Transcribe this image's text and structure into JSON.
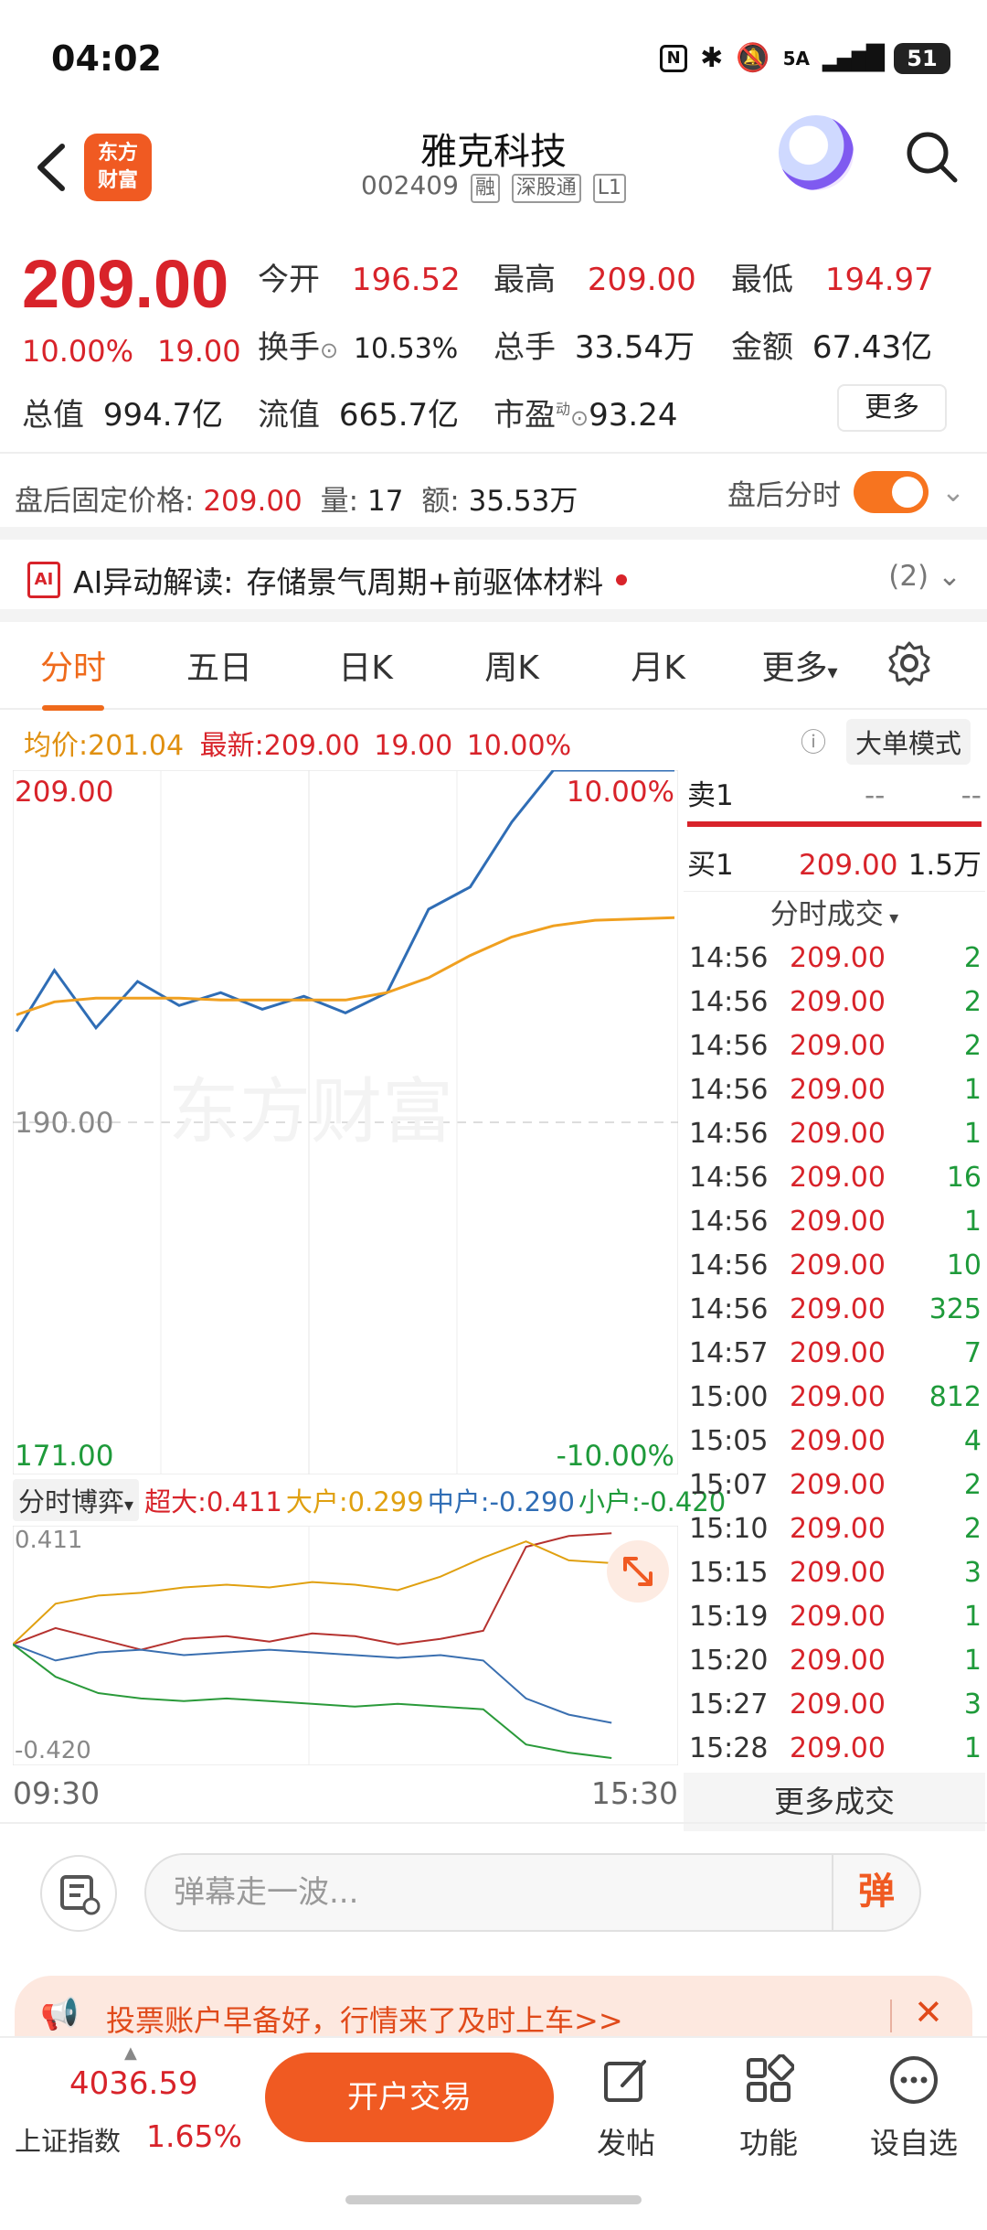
{
  "status": {
    "time": "04:02",
    "network": "5A",
    "battery": "51"
  },
  "header": {
    "logo_text": "东方财富",
    "name": "雅克科技",
    "code": "002409",
    "tags": [
      "融",
      "深股通",
      "L1"
    ]
  },
  "quote": {
    "price": "209.00",
    "pct": "10.00%",
    "change": "19.00",
    "rows": [
      [
        {
          "l": "今开",
          "v": "196.52",
          "c": "red"
        },
        {
          "l": "最高",
          "v": "209.00",
          "c": "red"
        },
        {
          "l": "最低",
          "v": "194.97",
          "c": "red"
        }
      ],
      [
        {
          "l": "换手",
          "v": "10.53%",
          "c": "dark",
          "info": true
        },
        {
          "l": "总手",
          "v": "33.54万",
          "c": "dark"
        },
        {
          "l": "金额",
          "v": "67.43亿",
          "c": "dark"
        }
      ],
      [
        {
          "l": "总值",
          "v": "994.7亿",
          "c": "dark"
        },
        {
          "l": "流值",
          "v": "665.7亿",
          "c": "dark"
        },
        {
          "l": "市盈",
          "v": "93.24",
          "c": "dark",
          "sup": "动",
          "info": true
        }
      ]
    ],
    "more_label": "更多"
  },
  "after_hours": {
    "label": "盘后固定价格:",
    "price": "209.00",
    "vol_label": "量:",
    "vol": "17",
    "amt_label": "额:",
    "amt": "35.53万",
    "toggle_label": "盘后分时"
  },
  "ai": {
    "label": "AI异动解读:",
    "text": "存储景气周期+前驱体材料",
    "count": "(2)"
  },
  "tabs": [
    "分时",
    "五日",
    "日K",
    "周K",
    "月K",
    "更多"
  ],
  "avg_row": {
    "avg_label": "均价:",
    "avg": "201.04",
    "latest_label": "最新:",
    "latest": "209.00",
    "chg": "19.00",
    "pct": "10.00%",
    "big_mode": "大单模式"
  },
  "chart": {
    "top_price": "209.00",
    "top_pct": "10.00%",
    "mid_price": "190.00",
    "bottom_price": "171.00",
    "bottom_pct": "-10.00%",
    "watermark": "东方财富",
    "time_start": "09:30",
    "time_end": "15:30"
  },
  "chart_data": {
    "type": "line",
    "ylim": [
      171.0,
      209.0
    ],
    "series": [
      {
        "name": "最新",
        "color": "#2f6db5",
        "x": [
          "09:30",
          "09:45",
          "10:00",
          "10:15",
          "10:30",
          "10:45",
          "11:00",
          "11:15",
          "11:30",
          "13:15",
          "13:30",
          "13:45",
          "14:00",
          "14:15",
          "14:30",
          "15:00"
        ],
        "values": [
          194.9,
          198.2,
          195.1,
          197.6,
          196.3,
          197.0,
          196.1,
          196.8,
          195.9,
          197.0,
          201.5,
          202.7,
          206.2,
          209.0,
          209.0,
          209.0
        ]
      },
      {
        "name": "均价",
        "color": "#f0a020",
        "x": [
          "09:30",
          "09:45",
          "10:00",
          "10:15",
          "10:30",
          "10:45",
          "11:00",
          "11:15",
          "11:30",
          "13:15",
          "13:30",
          "13:45",
          "14:00",
          "14:15",
          "14:30",
          "15:00"
        ],
        "values": [
          195.8,
          196.5,
          196.7,
          196.7,
          196.7,
          196.6,
          196.6,
          196.6,
          196.6,
          197.0,
          197.8,
          199.0,
          200.0,
          200.6,
          200.9,
          201.04
        ]
      }
    ]
  },
  "flow": {
    "label": "分时博弈",
    "items": [
      {
        "l": "超大:",
        "v": "0.411",
        "color": "#d8232a"
      },
      {
        "l": "大户:",
        "v": "0.299",
        "color": "#e0a010"
      },
      {
        "l": "中户:",
        "v": "-0.290",
        "color": "#2f6db5"
      },
      {
        "l": "小户:",
        "v": "-0.420",
        "color": "#1e9a3a"
      }
    ],
    "max": "0.411",
    "min": "-0.420",
    "chart_data": {
      "type": "line",
      "ylim": [
        -0.42,
        0.411
      ],
      "series": [
        {
          "name": "超大",
          "color": "#b5322f",
          "values": [
            0.0,
            0.06,
            0.02,
            -0.02,
            0.02,
            0.03,
            0.01,
            0.04,
            0.03,
            0.0,
            0.02,
            0.05,
            0.36,
            0.4,
            0.41
          ]
        },
        {
          "name": "大户",
          "color": "#e0a010",
          "values": [
            0.0,
            0.15,
            0.18,
            0.19,
            0.21,
            0.22,
            0.21,
            0.23,
            0.22,
            0.2,
            0.25,
            0.32,
            0.38,
            0.31,
            0.3
          ]
        },
        {
          "name": "中户",
          "color": "#3a6fb0",
          "values": [
            0.0,
            -0.06,
            -0.03,
            -0.02,
            -0.04,
            -0.03,
            -0.02,
            -0.03,
            -0.04,
            -0.05,
            -0.04,
            -0.06,
            -0.2,
            -0.26,
            -0.29
          ]
        },
        {
          "name": "小户",
          "color": "#2a9a3a",
          "values": [
            0.0,
            -0.12,
            -0.18,
            -0.2,
            -0.21,
            -0.2,
            -0.21,
            -0.22,
            -0.23,
            -0.22,
            -0.23,
            -0.24,
            -0.37,
            -0.4,
            -0.42
          ]
        }
      ]
    }
  },
  "orderbook": {
    "sell1_label": "卖1",
    "sell1_price": "--",
    "sell1_vol": "--",
    "buy1_label": "买1",
    "buy1_price": "209.00",
    "buy1_vol": "1.5万",
    "ticks_label": "分时成交",
    "ticks": [
      {
        "t": "14:56",
        "p": "209.00",
        "v": "2"
      },
      {
        "t": "14:56",
        "p": "209.00",
        "v": "2"
      },
      {
        "t": "14:56",
        "p": "209.00",
        "v": "2"
      },
      {
        "t": "14:56",
        "p": "209.00",
        "v": "1"
      },
      {
        "t": "14:56",
        "p": "209.00",
        "v": "1"
      },
      {
        "t": "14:56",
        "p": "209.00",
        "v": "16"
      },
      {
        "t": "14:56",
        "p": "209.00",
        "v": "1"
      },
      {
        "t": "14:56",
        "p": "209.00",
        "v": "10"
      },
      {
        "t": "14:56",
        "p": "209.00",
        "v": "325"
      },
      {
        "t": "14:57",
        "p": "209.00",
        "v": "7"
      },
      {
        "t": "15:00",
        "p": "209.00",
        "v": "812"
      },
      {
        "t": "15:05",
        "p": "209.00",
        "v": "4"
      },
      {
        "t": "15:07",
        "p": "209.00",
        "v": "2"
      },
      {
        "t": "15:10",
        "p": "209.00",
        "v": "2"
      },
      {
        "t": "15:15",
        "p": "209.00",
        "v": "3"
      },
      {
        "t": "15:19",
        "p": "209.00",
        "v": "1"
      },
      {
        "t": "15:20",
        "p": "209.00",
        "v": "1"
      },
      {
        "t": "15:27",
        "p": "209.00",
        "v": "3"
      },
      {
        "t": "15:28",
        "p": "209.00",
        "v": "1"
      }
    ],
    "more_label": "更多成交"
  },
  "comment": {
    "placeholder": "弹幕走一波...",
    "danmu_label": "弹"
  },
  "banner": {
    "text": "投票账户早备好，行情来了及时上车>>"
  },
  "bottom": {
    "index_value": "4036.59",
    "index_name": "上证指数",
    "index_pct": "1.65%",
    "trade_label": "开户交易",
    "nav": [
      "发帖",
      "功能",
      "设自选"
    ]
  }
}
